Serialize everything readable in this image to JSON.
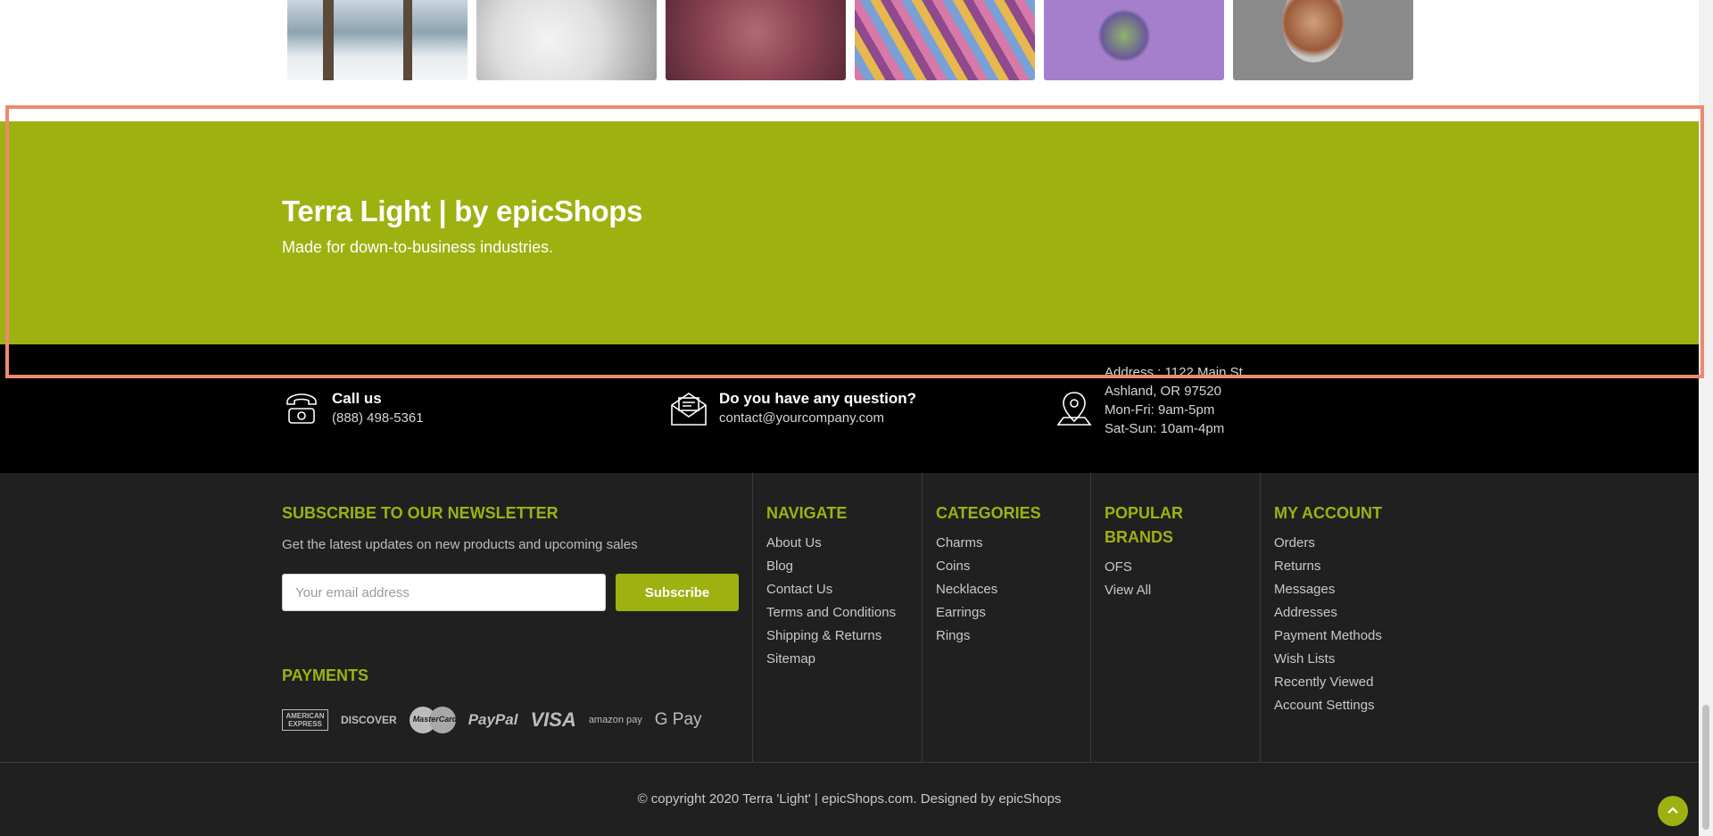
{
  "brand": {
    "title": "Terra Light | by epicShops",
    "tagline": "Made for down-to-business industries.",
    "accent_color": "#9db111"
  },
  "contact": {
    "call": {
      "title": "Call us",
      "phone": "(888) 498-5361",
      "icon": "phone-icon"
    },
    "question": {
      "title": "Do you have any question?",
      "email": "contact@yourcompany.com",
      "icon": "envelope-icon"
    },
    "address": {
      "icon": "map-pin-icon",
      "lines": [
        "Address : 1122 Main St",
        "Ashland, OR 97520",
        "Mon-Fri: 9am-5pm",
        "Sat-Sun: 10am-4pm"
      ]
    }
  },
  "newsletter": {
    "heading": "SUBSCRIBE TO OUR NEWSLETTER",
    "description": "Get the latest updates on new products and upcoming sales",
    "placeholder": "Your email address",
    "button": "Subscribe"
  },
  "payments": {
    "heading": "PAYMENTS",
    "methods": [
      "AMERICAN EXPRESS",
      "DISCOVER",
      "MasterCard",
      "PayPal",
      "VISA",
      "amazon pay",
      "G Pay"
    ]
  },
  "navigate": {
    "heading": "NAVIGATE",
    "links": [
      "About Us",
      "Blog",
      "Contact Us",
      "Terms and Conditions",
      "Shipping & Returns",
      "Sitemap"
    ]
  },
  "categories": {
    "heading": "CATEGORIES",
    "links": [
      "Charms",
      "Coins",
      "Necklaces",
      "Earrings",
      "Rings"
    ]
  },
  "brands": {
    "heading_line1": "POPULAR",
    "heading_line2": "BRANDS",
    "links": [
      "OFS",
      "View All"
    ]
  },
  "account": {
    "heading": "MY ACCOUNT",
    "links": [
      "Orders",
      "Returns",
      "Messages",
      "Addresses",
      "Payment Methods",
      "Wish Lists",
      "Recently Viewed",
      "Account Settings"
    ]
  },
  "footer": {
    "copyright": "© copyright 2020 Terra 'Light' | epicShops.com. Designed by epicShops"
  },
  "back_to_top": {
    "icon": "chevron-up-icon"
  }
}
